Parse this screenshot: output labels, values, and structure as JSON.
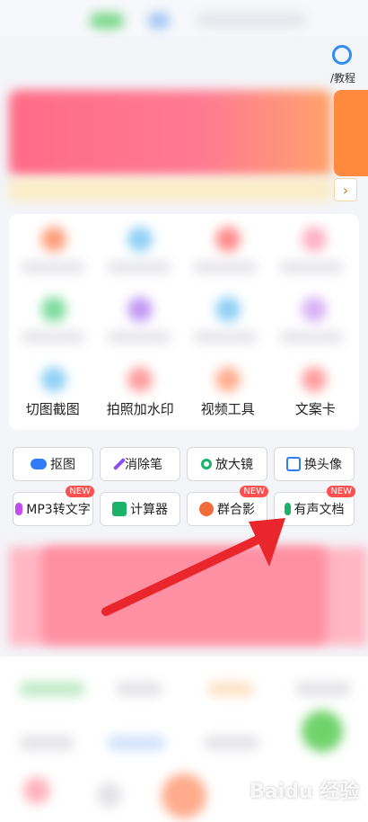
{
  "header": {
    "help_label": "/教程"
  },
  "notice": {
    "arrow": "›"
  },
  "tool_grid": {
    "visible_labels": [
      "切图截图",
      "拍照加水印",
      "视频工具",
      "文案卡"
    ]
  },
  "quick_buttons": {
    "row1": [
      {
        "label": "抠图",
        "icon": "toggle-icon",
        "color": "#2f7cf6"
      },
      {
        "label": "消除笔",
        "icon": "magic-wand-icon",
        "color": "#8b4cf0"
      },
      {
        "label": "放大镜",
        "icon": "magnifier-icon",
        "color": "#1bb36a"
      },
      {
        "label": "换头像",
        "icon": "avatar-swap-icon",
        "color": "#2f7cf6"
      }
    ],
    "row2": [
      {
        "label": "MP3转文字",
        "icon": "music-note-icon",
        "color": "#c24cf0",
        "badge": "NEW"
      },
      {
        "label": "计算器",
        "icon": "calculator-icon",
        "color": "#1bb36a"
      },
      {
        "label": "群合影",
        "icon": "group-photo-icon",
        "color": "#f26b3a",
        "badge": "NEW"
      },
      {
        "label": "有声文档",
        "icon": "microphone-icon",
        "color": "#1bb36a",
        "badge": "NEW"
      }
    ]
  },
  "watermark": "Baidu 经验",
  "colors": {
    "accent_red": "#e8262c",
    "badge": "#ff4f4f"
  }
}
